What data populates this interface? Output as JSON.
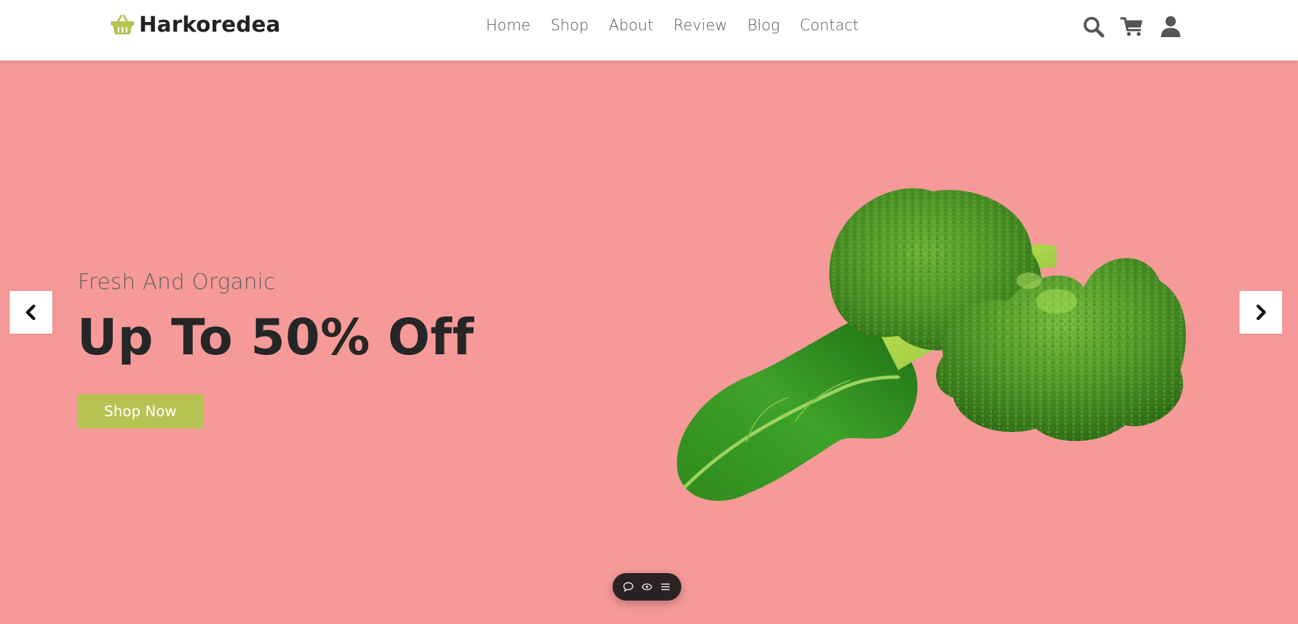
{
  "brand": {
    "name": "Harkoredea",
    "accent_color": "#b6c252",
    "icon": "basket-icon"
  },
  "nav": {
    "items": [
      {
        "label": "Home"
      },
      {
        "label": "Shop"
      },
      {
        "label": "About"
      },
      {
        "label": "Review"
      },
      {
        "label": "Blog"
      },
      {
        "label": "Contact"
      }
    ]
  },
  "header_icons": [
    "search-icon",
    "cart-icon",
    "user-icon"
  ],
  "hero": {
    "subtitle": "Fresh And Organic",
    "title": "Up To 50% Off",
    "cta_label": "Shop Now",
    "background_color": "#f59a98",
    "image": "broccoli-image"
  },
  "slider": {
    "prev_icon": "chevron-left-icon",
    "next_icon": "chevron-right-icon"
  },
  "dock": {
    "icons": [
      "comment-icon",
      "eye-icon",
      "menu-icon"
    ]
  }
}
